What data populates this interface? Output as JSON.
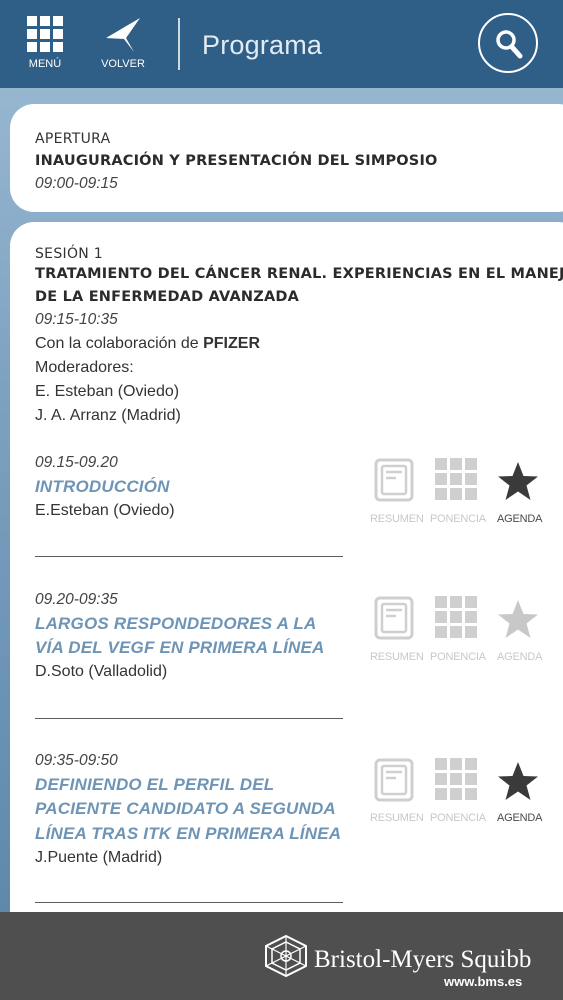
{
  "header": {
    "menu_label": "MENÚ",
    "back_label": "VOLVER",
    "title": "Programa"
  },
  "opening": {
    "label": "APERTURA",
    "title": "INAUGURACIÓN Y PRESENTACIÓN DEL SIMPOSIO",
    "time": "09:00-09:15"
  },
  "session": {
    "label": "SESIÓN 1",
    "title_line1": "TRATAMIENTO DEL CÁNCER RENAL. EXPERIENCIAS EN EL MANEJO",
    "title_line2": "DE LA ENFERMEDAD AVANZADA",
    "time": "09:15-10:35",
    "collab_prefix": "Con la colaboración de ",
    "collab_name": "PFIZER",
    "moderators_label": "Moderadores:",
    "moderators": [
      "E. Esteban (Oviedo)",
      "J. A. Arranz (Madrid)"
    ]
  },
  "action_labels": {
    "summary": "RESUMEN",
    "presentation": "PONENCIA",
    "agenda": "AGENDA"
  },
  "talks": [
    {
      "time": "09.15-09.20",
      "title_lines": [
        "INTRODUCCIÓN"
      ],
      "speaker": "E.Esteban (Oviedo)",
      "in_agenda": true
    },
    {
      "time": "09.20-09:35",
      "title_lines": [
        "LARGOS RESPONDEDORES A LA",
        "VÍA DEL VEGF EN PRIMERA LÍNEA"
      ],
      "speaker": "D.Soto (Valladolid)",
      "in_agenda": false
    },
    {
      "time": "09:35-09:50",
      "title_lines": [
        "DEFINIENDO EL PERFIL DEL",
        "PACIENTE CANDIDATO A SEGUNDA",
        "LÍNEA TRAS ITK EN PRIMERA LÍNEA"
      ],
      "speaker": "J.Puente (Madrid)",
      "in_agenda": true
    }
  ],
  "footer": {
    "brand": "Bristol-Myers Squibb",
    "url": "www.bms.es"
  },
  "colors": {
    "header_bg": "#2f5e87",
    "talk_title": "#6e94b6",
    "footer_bg": "#4f4f4f",
    "star_active": "#3a3a3a",
    "star_inactive": "#c8c8c8"
  }
}
